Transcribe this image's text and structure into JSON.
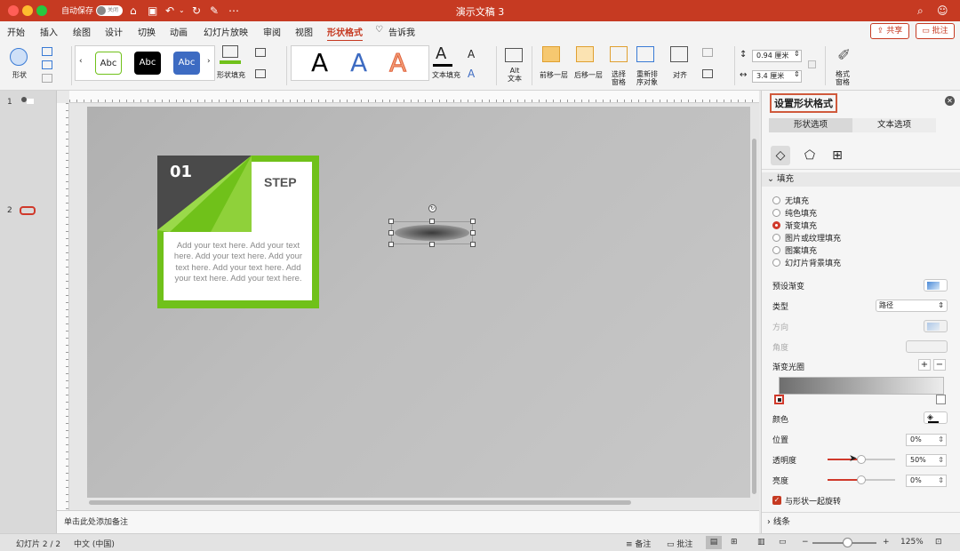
{
  "window": {
    "title": "演示文稿 3",
    "autosave_label": "自动保存",
    "autosave_state": "关闭"
  },
  "menu": {
    "tabs": [
      "开始",
      "插入",
      "绘图",
      "设计",
      "切换",
      "动画",
      "幻灯片放映",
      "审阅",
      "视图",
      "形状格式"
    ],
    "tell_me": "告诉我",
    "share": "共享",
    "comments": "批注"
  },
  "ribbon": {
    "shapes_label": "形状",
    "style_samples": [
      "Abc",
      "Abc",
      "Abc"
    ],
    "shape_fill_label": "形状填充",
    "wordart_letters": [
      "A",
      "A",
      "A"
    ],
    "text_fill_label": "文本填充",
    "alt_text_label": "Alt\n文本",
    "bring_forward": "前移一层",
    "send_backward": "后移一层",
    "selection_pane": "选择\n窗格",
    "reorder_objects": "重新排\n序对象",
    "align": "对齐",
    "height_value": "0.94 厘米",
    "width_value": "3.4 厘米",
    "format_pane": "格式\n窗格"
  },
  "thumbnails": {
    "numbers": [
      "1",
      "2"
    ]
  },
  "slide": {
    "card_number": "01",
    "card_heading": "STEP",
    "card_body": "Add your text here. Add your text here. Add your text here. Add your text here. Add your text here. Add your text here. Add your text here."
  },
  "notes_placeholder": "单击此处添加备注",
  "panel": {
    "title": "设置形状格式",
    "tab_shape": "形状选项",
    "tab_text": "文本选项",
    "fill_section": "填充",
    "fill_options": [
      "无填充",
      "纯色填充",
      "渐变填充",
      "图片或纹理填充",
      "图案填充",
      "幻灯片背景填充"
    ],
    "fill_selected_index": 2,
    "preset_gradient_label": "预设渐变",
    "type_label": "类型",
    "type_value": "路径",
    "direction_label": "方向",
    "angle_label": "角度",
    "gradient_stops_label": "渐变光圈",
    "color_label": "颜色",
    "position_label": "位置",
    "position_value": "0%",
    "transparency_label": "透明度",
    "transparency_value": "50%",
    "transparency_fraction": 0.5,
    "brightness_label": "亮度",
    "brightness_value": "0%",
    "rotate_with_shape_label": "与形状一起旋转",
    "line_section": "线条"
  },
  "statusbar": {
    "slide_info": "幻灯片 2 / 2",
    "language": "中文 (中国)",
    "notes_label": "备注",
    "comments_label": "批注",
    "zoom_value": "125%"
  },
  "colors": {
    "accent": "#c63a22",
    "card_green": "#70c11a",
    "card_dark": "#4a4a4a"
  }
}
